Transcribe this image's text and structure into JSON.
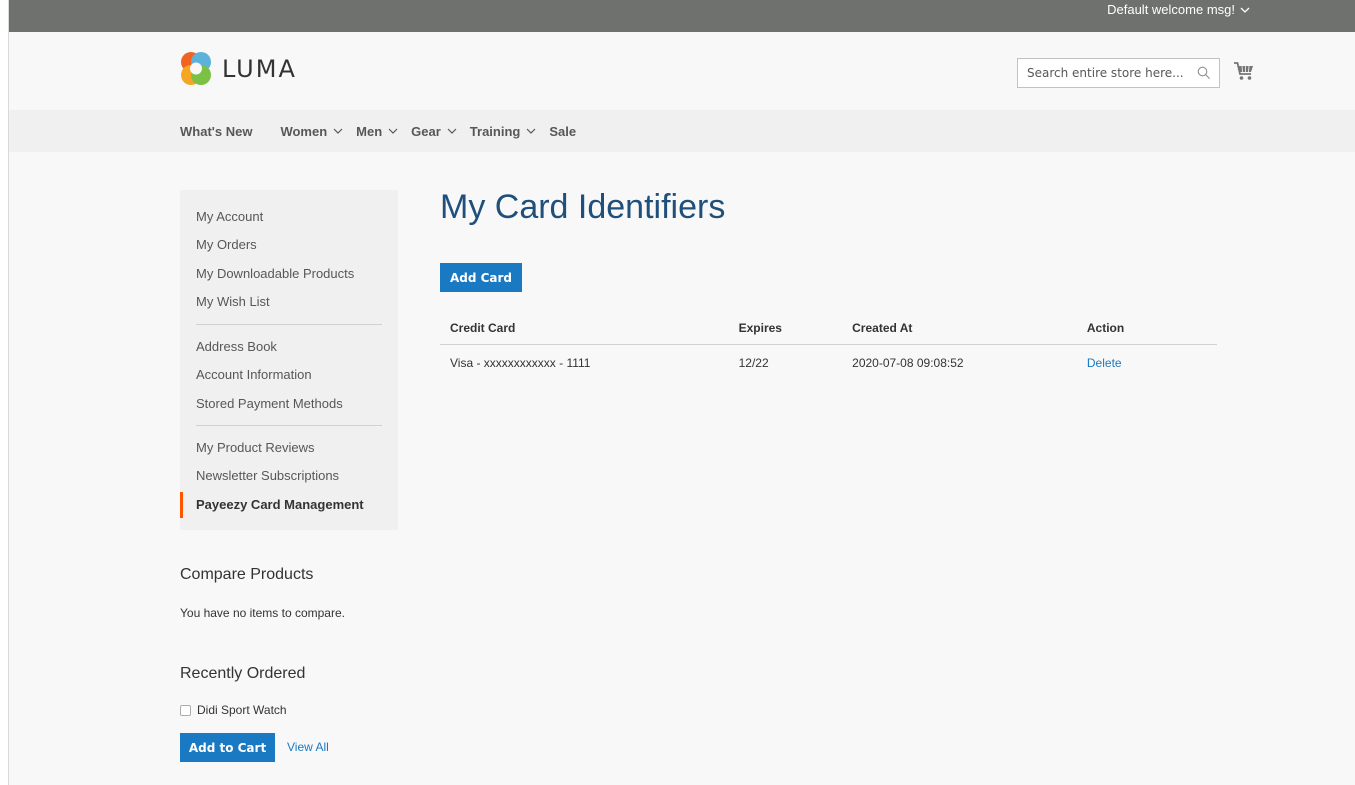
{
  "header": {
    "welcome": "Default welcome msg!",
    "logo_text": "LUMA",
    "search_placeholder": "Search entire store here..."
  },
  "nav": {
    "items": [
      {
        "label": "What's New"
      },
      {
        "label": "Women"
      },
      {
        "label": "Men"
      },
      {
        "label": "Gear"
      },
      {
        "label": "Training"
      },
      {
        "label": "Sale"
      }
    ]
  },
  "sidebar": {
    "items": [
      {
        "label": "My Account"
      },
      {
        "label": "My Orders"
      },
      {
        "label": "My Downloadable Products"
      },
      {
        "label": "My Wish List"
      },
      {
        "label": "Address Book"
      },
      {
        "label": "Account Information"
      },
      {
        "label": "Stored Payment Methods"
      },
      {
        "label": "My Product Reviews"
      },
      {
        "label": "Newsletter Subscriptions"
      },
      {
        "label": "Payeezy Card Management"
      }
    ]
  },
  "compare": {
    "title": "Compare Products",
    "empty_text": "You have no items to compare."
  },
  "recently_ordered": {
    "title": "Recently Ordered",
    "items": [
      {
        "name": "Didi Sport Watch"
      }
    ],
    "add_to_cart_label": "Add to Cart",
    "view_all_label": "View All"
  },
  "main": {
    "title": "My Card Identifiers",
    "add_card_label": "Add Card",
    "table": {
      "headers": [
        "Credit Card",
        "Expires",
        "Created At",
        "Action"
      ],
      "rows": [
        {
          "credit_card": "Visa - xxxxxxxxxxxx - 1111",
          "expires": "12/22",
          "created_at": "2020-07-08 09:08:52",
          "action": "Delete"
        }
      ]
    }
  },
  "colors": {
    "accent": "#1979c3",
    "title": "#1f4f7a",
    "current_marker": "#ff5501",
    "top_panel": "#6e716e"
  }
}
